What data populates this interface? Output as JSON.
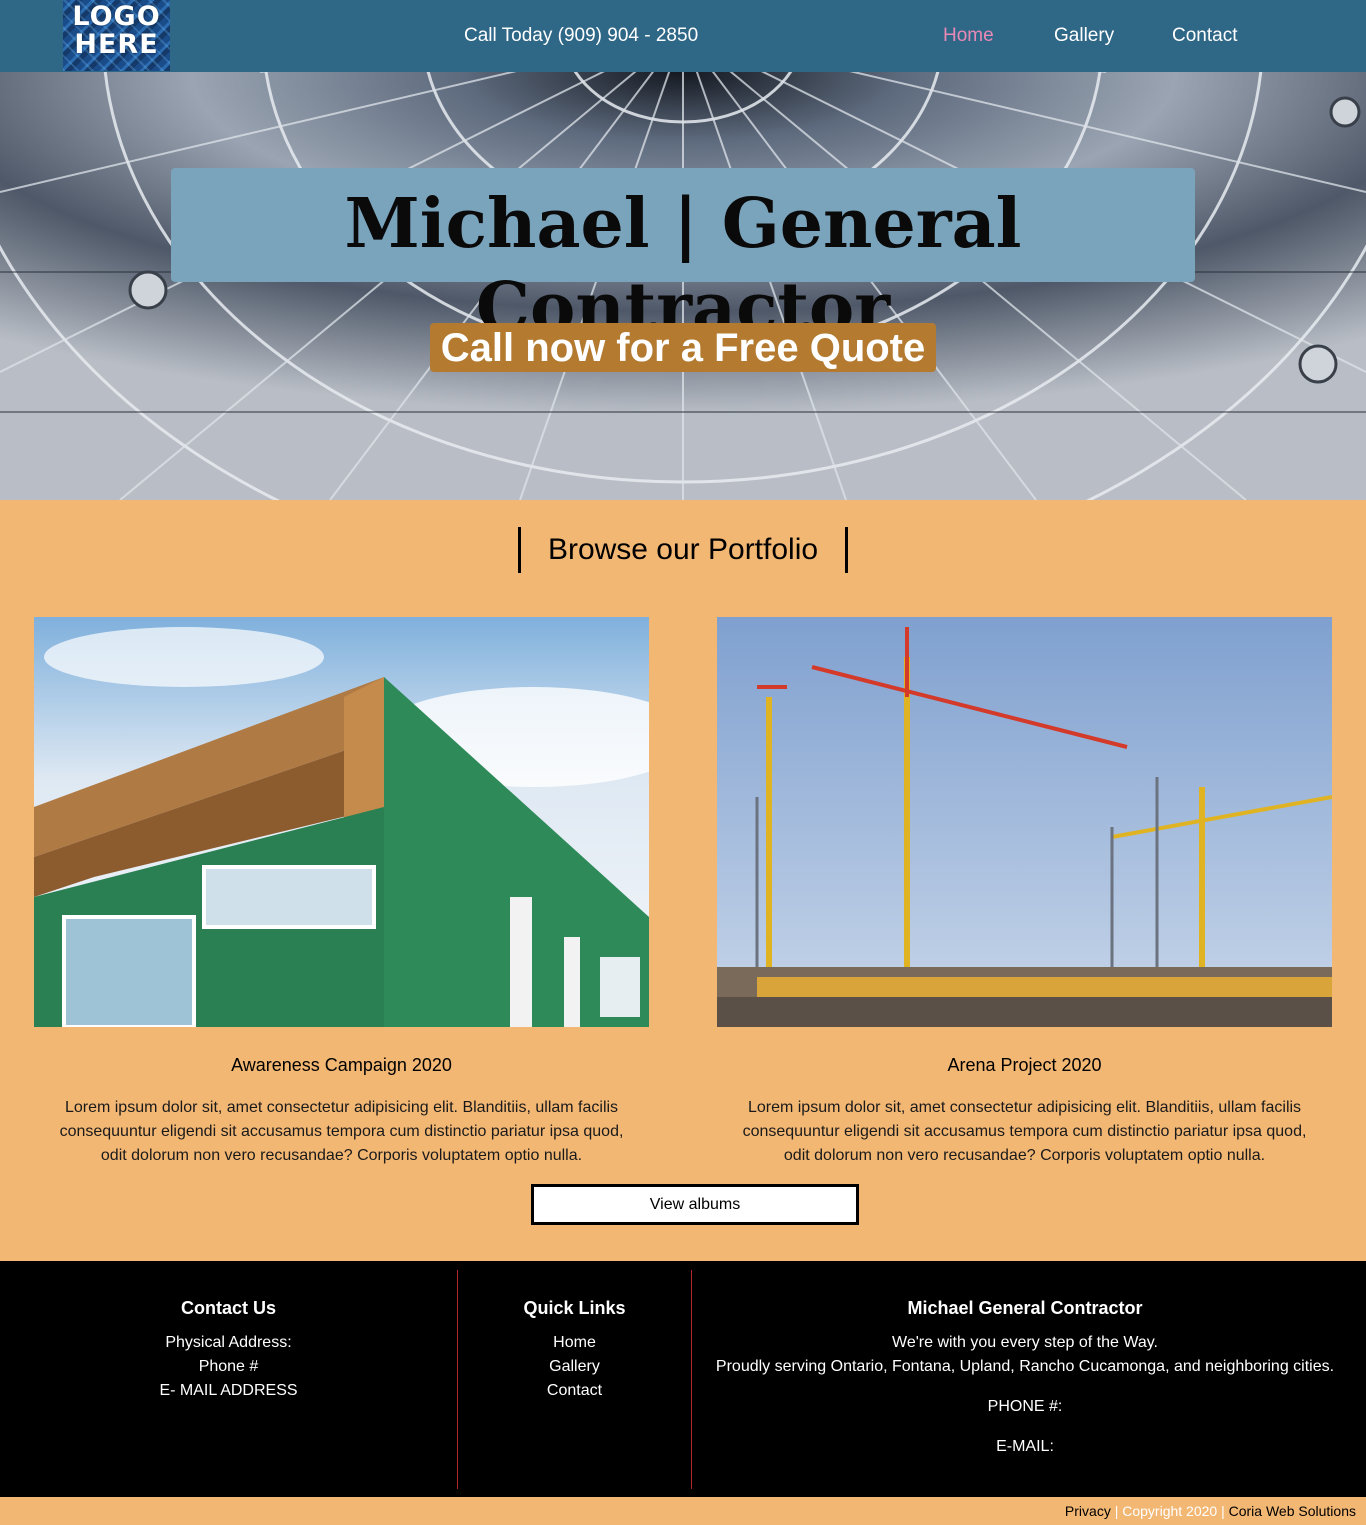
{
  "nav": {
    "logo_text_line1": "LOGO",
    "logo_text_line2": "HERE",
    "phone": "Call Today (909) 904 - 2850",
    "links": [
      {
        "label": "Home",
        "active": true
      },
      {
        "label": "Gallery",
        "active": false
      },
      {
        "label": "Contact",
        "active": false
      }
    ],
    "active_color": "#e889b6",
    "bg_color": "#2f6787"
  },
  "hero": {
    "title": "Michael | General Contractor",
    "cta": "Call now for a Free Quote",
    "title_box_color": "#7aa3bc",
    "cta_color": "#b37a30"
  },
  "portfolio": {
    "heading": "Browse our Portfolio",
    "cards": [
      {
        "title": "Awareness Campaign 2020",
        "body": "Lorem ipsum dolor sit, amet consectetur adipisicing elit. Blanditiis, ullam facilis consequuntur eligendi sit accusamus tempora cum distinctio pariatur ipsa quod, odit dolorum non vero recusandae? Corporis voluptatem optio nulla."
      },
      {
        "title": "Arena Project 2020",
        "body": "Lorem ipsum dolor sit, amet consectetur adipisicing elit. Blanditiis, ullam facilis consequuntur eligendi sit accusamus tempora cum distinctio pariatur ipsa quod, odit dolorum non vero recusandae? Corporis voluptatem optio nulla."
      }
    ],
    "button": "View albums",
    "bg_color": "#f3b774"
  },
  "footer": {
    "contact": {
      "heading": "Contact Us",
      "lines": [
        "Physical Address:",
        "Phone #",
        "E- MAIL ADDRESS"
      ]
    },
    "quick_links": {
      "heading": "Quick Links",
      "links": [
        "Home",
        "Gallery",
        "Contact"
      ]
    },
    "company": {
      "heading": "Michael General Contractor",
      "tagline1": "We're with you every step of the Way.",
      "tagline2": "Proudly serving Ontario, Fontana, Upland, Rancho Cucamonga, and neighboring cities.",
      "phone": "PHONE #:",
      "email": "E-MAIL:"
    },
    "divider_color": "#b3262b"
  },
  "bottom": {
    "privacy": "Privacy",
    "sep1": " | ",
    "copyright": "Copyright 2020",
    "sep2": " | ",
    "credit": "Coria Web Solutions"
  }
}
